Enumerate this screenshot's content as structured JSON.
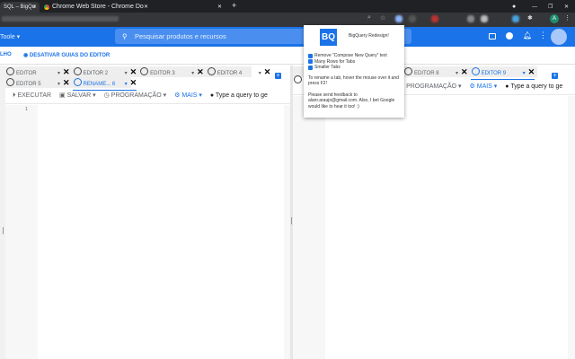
{
  "browser": {
    "tabs": [
      {
        "title": "SQL – BigQu"
      },
      {
        "title": "Chrome Web Store - Chrome Do"
      },
      {
        "title": ""
      }
    ],
    "new_tab": "+"
  },
  "header": {
    "project": "Toole",
    "search_placeholder": "Pesquisar produtos e recursos"
  },
  "subbar": {
    "truncated_label": "LHO",
    "toggle_guides": "DESATIVAR GUIAS DO EDITOR"
  },
  "left_panel": {
    "tabs_row1": [
      {
        "label": "EDITOR"
      },
      {
        "label": "EDITOR  2"
      },
      {
        "label": "EDITOR  3"
      },
      {
        "label": "EDITOR  4"
      }
    ],
    "tabs_row2": [
      {
        "label": "EDITOR  5"
      },
      {
        "label": "RENAME... 6",
        "active": true
      }
    ],
    "toolbar": {
      "run": "EXECUTAR",
      "save": "SALVAR",
      "schedule": "PROGRAMAÇÃO",
      "more": "MAIS",
      "hint": "Type a query to ge"
    },
    "line_number": "1"
  },
  "right_panel": {
    "tabs": [
      {
        "label": "EDITOR  8"
      },
      {
        "label": "EDITOR  9",
        "active": true
      }
    ],
    "toolbar": {
      "schedule": "PROGRAMAÇÃO",
      "more": "MAIS",
      "hint": "Type a query to ge"
    }
  },
  "popup": {
    "logo": "BQ",
    "title": "BigQuery Redesign!",
    "options": [
      {
        "label": "Remove \"Compose New Query\" text",
        "checked": true
      },
      {
        "label": "Many Rows for Tabs",
        "checked": true
      },
      {
        "label": "Smaller Tabs",
        "checked": true
      }
    ],
    "rename_hint": "To rename a tab, hover the mouse over it and press F2!",
    "feedback": "Please send feedback to alanr.araujo@gmail.com. Also, I bet Google would like to hear it too! :)"
  },
  "profile_initial": "A",
  "colors": {
    "accent": "#1a73e8",
    "chrome_dark": "#202124"
  }
}
